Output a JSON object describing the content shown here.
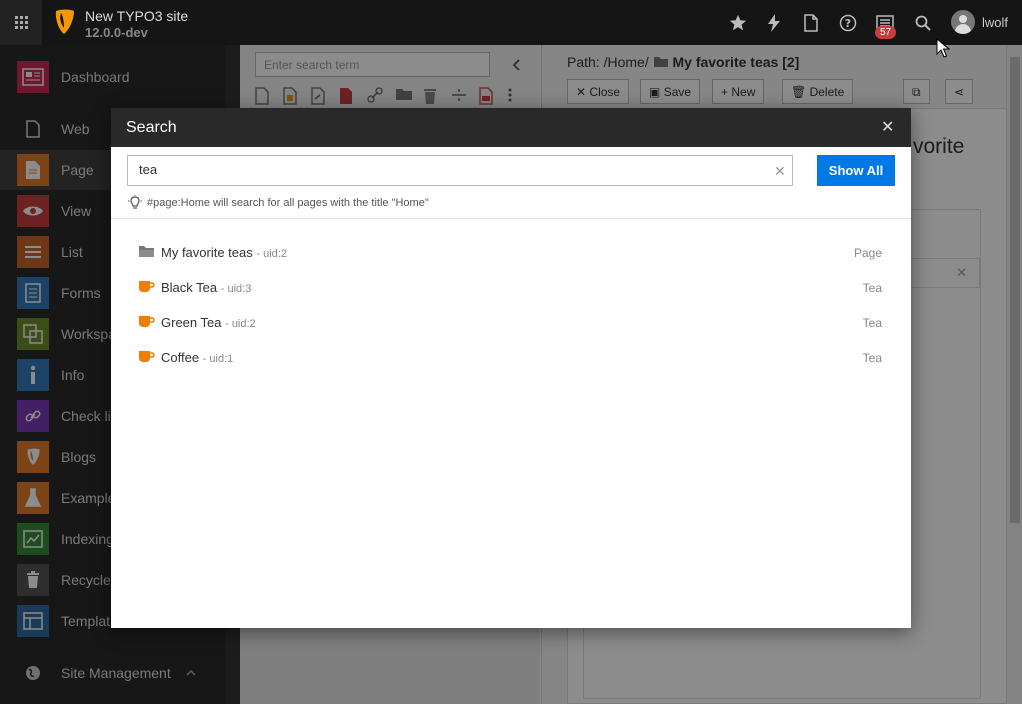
{
  "topbar": {
    "site_name": "New TYPO3 site",
    "site_version": "12.0.0-dev",
    "notification_count": "57",
    "username": "lwolf",
    "icons": [
      "star-icon",
      "lightning-icon",
      "document-icon",
      "help-icon",
      "list-icon",
      "search-icon"
    ]
  },
  "sidebar": {
    "items": [
      {
        "label": "Dashboard",
        "color": "#c92b59"
      },
      {
        "label": "Web",
        "color": "#2b2b2b"
      },
      {
        "label": "Page",
        "color": "#e07b2a"
      },
      {
        "label": "View",
        "color": "#c83c3c"
      },
      {
        "label": "List",
        "color": "#c8642d"
      },
      {
        "label": "Forms",
        "color": "#347ab8"
      },
      {
        "label": "Workspa",
        "color": "#6a8f2a"
      },
      {
        "label": "Info",
        "color": "#347ab8"
      },
      {
        "label": "Check lin",
        "color": "#7a3ab8"
      },
      {
        "label": "Blogs",
        "color": "#e07b2a"
      },
      {
        "label": "Example",
        "color": "#e07b2a"
      },
      {
        "label": "Indexing",
        "color": "#3a8a3a"
      },
      {
        "label": "Recycler",
        "color": "#555555"
      },
      {
        "label": "Templat",
        "color": "#2e6aa0"
      },
      {
        "label": "Site Management",
        "color": "#2b2b2b"
      }
    ]
  },
  "tree": {
    "search_placeholder": "Enter search term"
  },
  "content": {
    "path_prefix": "Path: /Home/",
    "path_page": "My favorite teas [2]",
    "buttons": {
      "close": "Close",
      "save": "Save",
      "new": "New",
      "delete": "Delete"
    },
    "heading_fragment": "vorite"
  },
  "modal": {
    "title": "Search",
    "query": "tea",
    "show_all": "Show All",
    "hint": "#page:Home will search for all pages with the title \"Home\"",
    "results": [
      {
        "name": "My favorite teas",
        "uid": "- uid:2",
        "type": "Page",
        "icon": "folder-icon"
      },
      {
        "name": "Black Tea",
        "uid": "- uid:3",
        "type": "Tea",
        "icon": "teacup-icon"
      },
      {
        "name": "Green Tea",
        "uid": "- uid:2",
        "type": "Tea",
        "icon": "teacup-icon"
      },
      {
        "name": "Coffee",
        "uid": "- uid:1",
        "type": "Tea",
        "icon": "teacup-icon"
      }
    ]
  },
  "colors": {
    "accent": "#0078e6",
    "typo3_orange": "#f49700",
    "topbar_bg": "#151515"
  }
}
